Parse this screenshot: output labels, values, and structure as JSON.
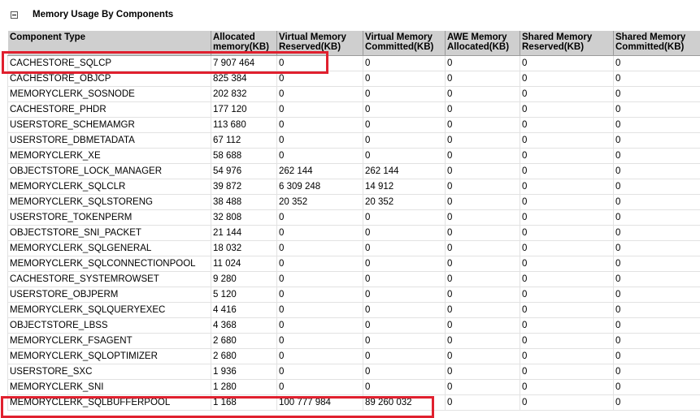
{
  "section": {
    "title": "Memory Usage By Components",
    "collapse_icon": "minus-box-icon"
  },
  "table": {
    "columns": [
      "Component Type",
      "Allocated memory(KB)",
      "Virtual Memory Reserved(KB)",
      "Virtual Memory Committed(KB)",
      "AWE Memory Allocated(KB)",
      "Shared Memory Reserved(KB)",
      "Shared Memory Committed(KB)"
    ],
    "rows": [
      [
        "CACHESTORE_SQLCP",
        "7 907 464",
        "0",
        "0",
        "0",
        "0",
        "0"
      ],
      [
        "CACHESTORE_OBJCP",
        "825 384",
        "0",
        "0",
        "0",
        "0",
        "0"
      ],
      [
        "MEMORYCLERK_SOSNODE",
        "202 832",
        "0",
        "0",
        "0",
        "0",
        "0"
      ],
      [
        "CACHESTORE_PHDR",
        "177 120",
        "0",
        "0",
        "0",
        "0",
        "0"
      ],
      [
        "USERSTORE_SCHEMAMGR",
        "113 680",
        "0",
        "0",
        "0",
        "0",
        "0"
      ],
      [
        "USERSTORE_DBMETADATA",
        "67 112",
        "0",
        "0",
        "0",
        "0",
        "0"
      ],
      [
        "MEMORYCLERK_XE",
        "58 688",
        "0",
        "0",
        "0",
        "0",
        "0"
      ],
      [
        "OBJECTSTORE_LOCK_MANAGER",
        "54 976",
        "262 144",
        "262 144",
        "0",
        "0",
        "0"
      ],
      [
        "MEMORYCLERK_SQLCLR",
        "39 872",
        "6 309 248",
        "14 912",
        "0",
        "0",
        "0"
      ],
      [
        "MEMORYCLERK_SQLSTORENG",
        "38 488",
        "20 352",
        "20 352",
        "0",
        "0",
        "0"
      ],
      [
        "USERSTORE_TOKENPERM",
        "32 808",
        "0",
        "0",
        "0",
        "0",
        "0"
      ],
      [
        "OBJECTSTORE_SNI_PACKET",
        "21 144",
        "0",
        "0",
        "0",
        "0",
        "0"
      ],
      [
        "MEMORYCLERK_SQLGENERAL",
        "18 032",
        "0",
        "0",
        "0",
        "0",
        "0"
      ],
      [
        "MEMORYCLERK_SQLCONNECTIONPOOL",
        "11 024",
        "0",
        "0",
        "0",
        "0",
        "0"
      ],
      [
        "CACHESTORE_SYSTEMROWSET",
        "9 280",
        "0",
        "0",
        "0",
        "0",
        "0"
      ],
      [
        "USERSTORE_OBJPERM",
        "5 120",
        "0",
        "0",
        "0",
        "0",
        "0"
      ],
      [
        "MEMORYCLERK_SQLQUERYEXEC",
        "4 416",
        "0",
        "0",
        "0",
        "0",
        "0"
      ],
      [
        "OBJECTSTORE_LBSS",
        "4 368",
        "0",
        "0",
        "0",
        "0",
        "0"
      ],
      [
        "MEMORYCLERK_FSAGENT",
        "2 680",
        "0",
        "0",
        "0",
        "0",
        "0"
      ],
      [
        "MEMORYCLERK_SQLOPTIMIZER",
        "2 680",
        "0",
        "0",
        "0",
        "0",
        "0"
      ],
      [
        "USERSTORE_SXC",
        "1 936",
        "0",
        "0",
        "0",
        "0",
        "0"
      ],
      [
        "MEMORYCLERK_SNI",
        "1 280",
        "0",
        "0",
        "0",
        "0",
        "0"
      ],
      [
        "MEMORYCLERK_SQLBUFFERPOOL",
        "1 168",
        "100 777 984",
        "89 260 032",
        "0",
        "0",
        "0"
      ]
    ]
  },
  "highlight_color": "#e0202e"
}
